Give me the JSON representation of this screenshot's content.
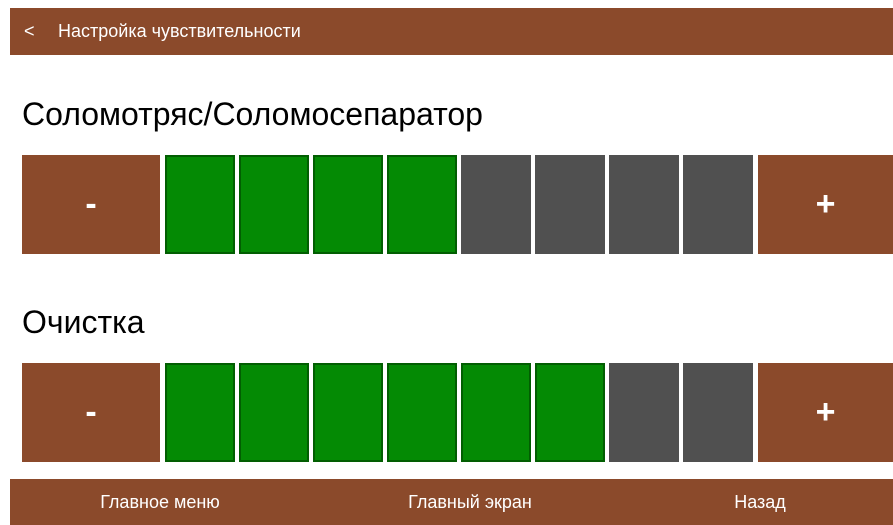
{
  "header": {
    "back_symbol": "<",
    "title": "Настройка чувствительности"
  },
  "sections": [
    {
      "title": "Соломотряс/Соломосепаратор",
      "minus_label": "-",
      "plus_label": "+",
      "level": 4,
      "max_level": 8
    },
    {
      "title": "Очистка",
      "minus_label": "-",
      "plus_label": "+",
      "level": 6,
      "max_level": 8
    }
  ],
  "footer": {
    "main_menu": "Главное меню",
    "main_screen": "Главный экран",
    "back": "Назад"
  },
  "colors": {
    "brand_brown": "#8b4a2b",
    "segment_active": "#048a04",
    "segment_inactive": "#505050"
  }
}
